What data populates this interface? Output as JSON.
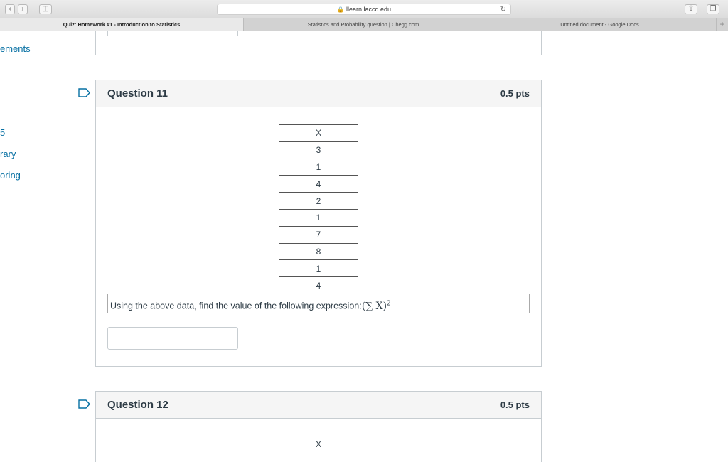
{
  "browser": {
    "url": "llearn.laccd.edu",
    "tabs": [
      {
        "label": "Quiz: Homework #1 - Introduction to Statistics",
        "active": true
      },
      {
        "label": "Statistics and Probability question | Chegg.com",
        "active": false
      },
      {
        "label": "Untitled document - Google Docs",
        "active": false
      }
    ]
  },
  "sidebar": {
    "items": [
      {
        "label": "ements"
      },
      {
        "label": "5"
      },
      {
        "label": "rary"
      },
      {
        "label": "oring"
      }
    ]
  },
  "questions": [
    {
      "title": "Question 11",
      "points": "0.5 pts",
      "table_header": "X",
      "values": [
        "3",
        "1",
        "4",
        "2",
        "1",
        "7",
        "8",
        "1",
        "4"
      ],
      "prompt": "Using the above data, find the value of the following expression:",
      "expression": "(∑ X)",
      "exponent": "2"
    },
    {
      "title": "Question 12",
      "points": "0.5 pts",
      "table_header": "X"
    }
  ]
}
